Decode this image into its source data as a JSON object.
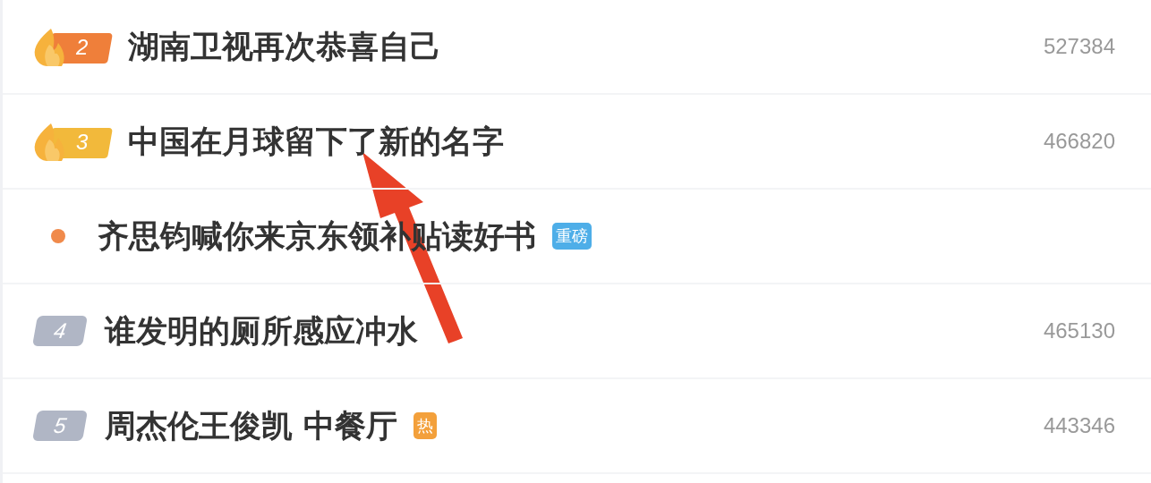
{
  "rows": [
    {
      "kind": "hot",
      "rank": "2",
      "color": "#ef7f3a",
      "title": "湖南卫视再次恭喜自己",
      "count": "527384"
    },
    {
      "kind": "hot",
      "rank": "3",
      "color": "#f2b93b",
      "title": "中国在月球留下了新的名字",
      "count": "466820"
    },
    {
      "kind": "ad",
      "color": "#f08a4b",
      "title": "齐思钧喊你来京东领补贴读好书",
      "tag": {
        "text": "重磅",
        "color": "#4eaee8"
      }
    },
    {
      "kind": "rank",
      "rank": "4",
      "title": "谁发明的厕所感应冲水",
      "count": "465130"
    },
    {
      "kind": "rank",
      "rank": "5",
      "title": "周杰伦王俊凯 中餐厅",
      "tag": {
        "text": "热",
        "color": "#f3a03b"
      },
      "count": "443346"
    }
  ]
}
